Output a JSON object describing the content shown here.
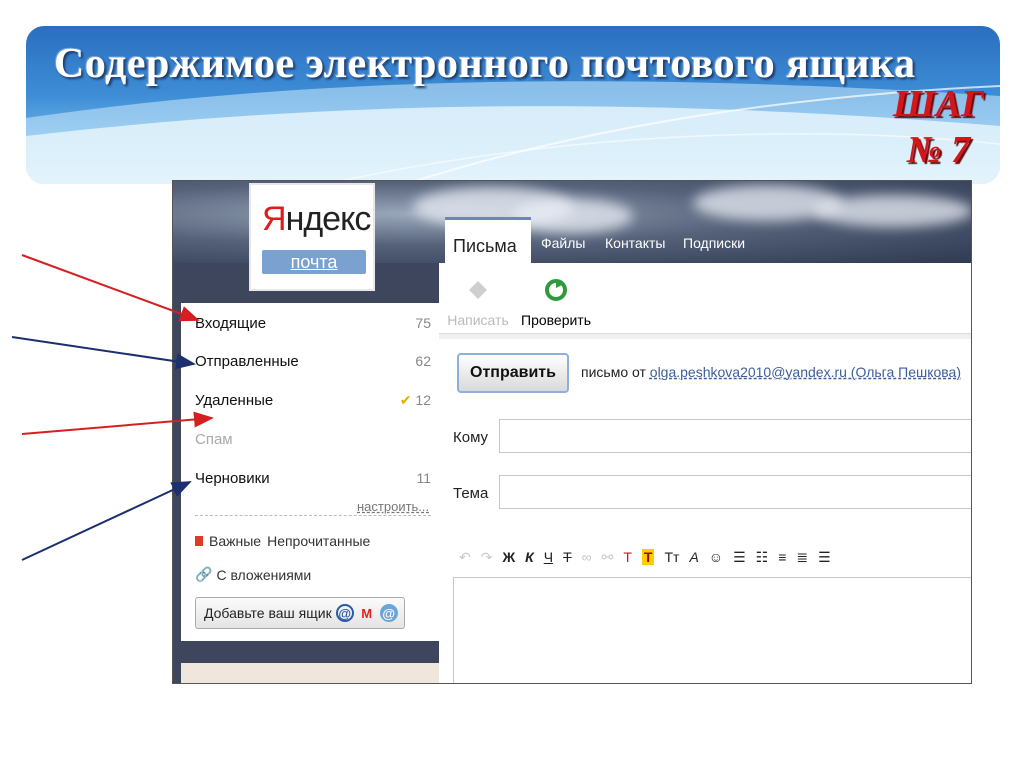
{
  "slide": {
    "title": "Содержимое  электронного почтового ящика",
    "step_word": "ШАГ",
    "step_number": "№ 7"
  },
  "logo": {
    "brand": "Яндекс",
    "brand_first": "Я",
    "brand_rest": "ндекс",
    "service": "почта"
  },
  "folders": [
    {
      "name": "Входящие",
      "count": "75"
    },
    {
      "name": "Отправленные",
      "count": "62"
    },
    {
      "name": "Удаленные",
      "count": "12"
    },
    {
      "name": "Спам",
      "count": ""
    },
    {
      "name": "Черновики",
      "count": "11"
    }
  ],
  "sidebar": {
    "setup_link": "настроить...",
    "filter_important": "Важные",
    "filter_unread": "Непрочитанные",
    "filter_attachments": "С вложениями",
    "add_mailbox": "Добавьте ваш ящик"
  },
  "tabs": [
    "Письма",
    "Файлы",
    "Контакты",
    "Подписки"
  ],
  "toolbar": {
    "compose": "Написать",
    "check": "Проверить"
  },
  "compose": {
    "send_button": "Отправить",
    "from_prefix": "письмо от",
    "from_address": "olga.peshkova2010@yandex.ru (Ольга Пешкова)",
    "to_label": "Кому",
    "subject_label": "Тема",
    "to_value": "",
    "subject_value": ""
  },
  "editor_tools": [
    "Ж",
    "К",
    "Ч",
    "Т",
    "Т",
    "Т",
    "Тт",
    "А"
  ],
  "colors": {
    "arrow_red": "#d42020",
    "arrow_blue": "#1c2f6e",
    "step_red": "#d4161b",
    "title_white": "#ffffff"
  }
}
